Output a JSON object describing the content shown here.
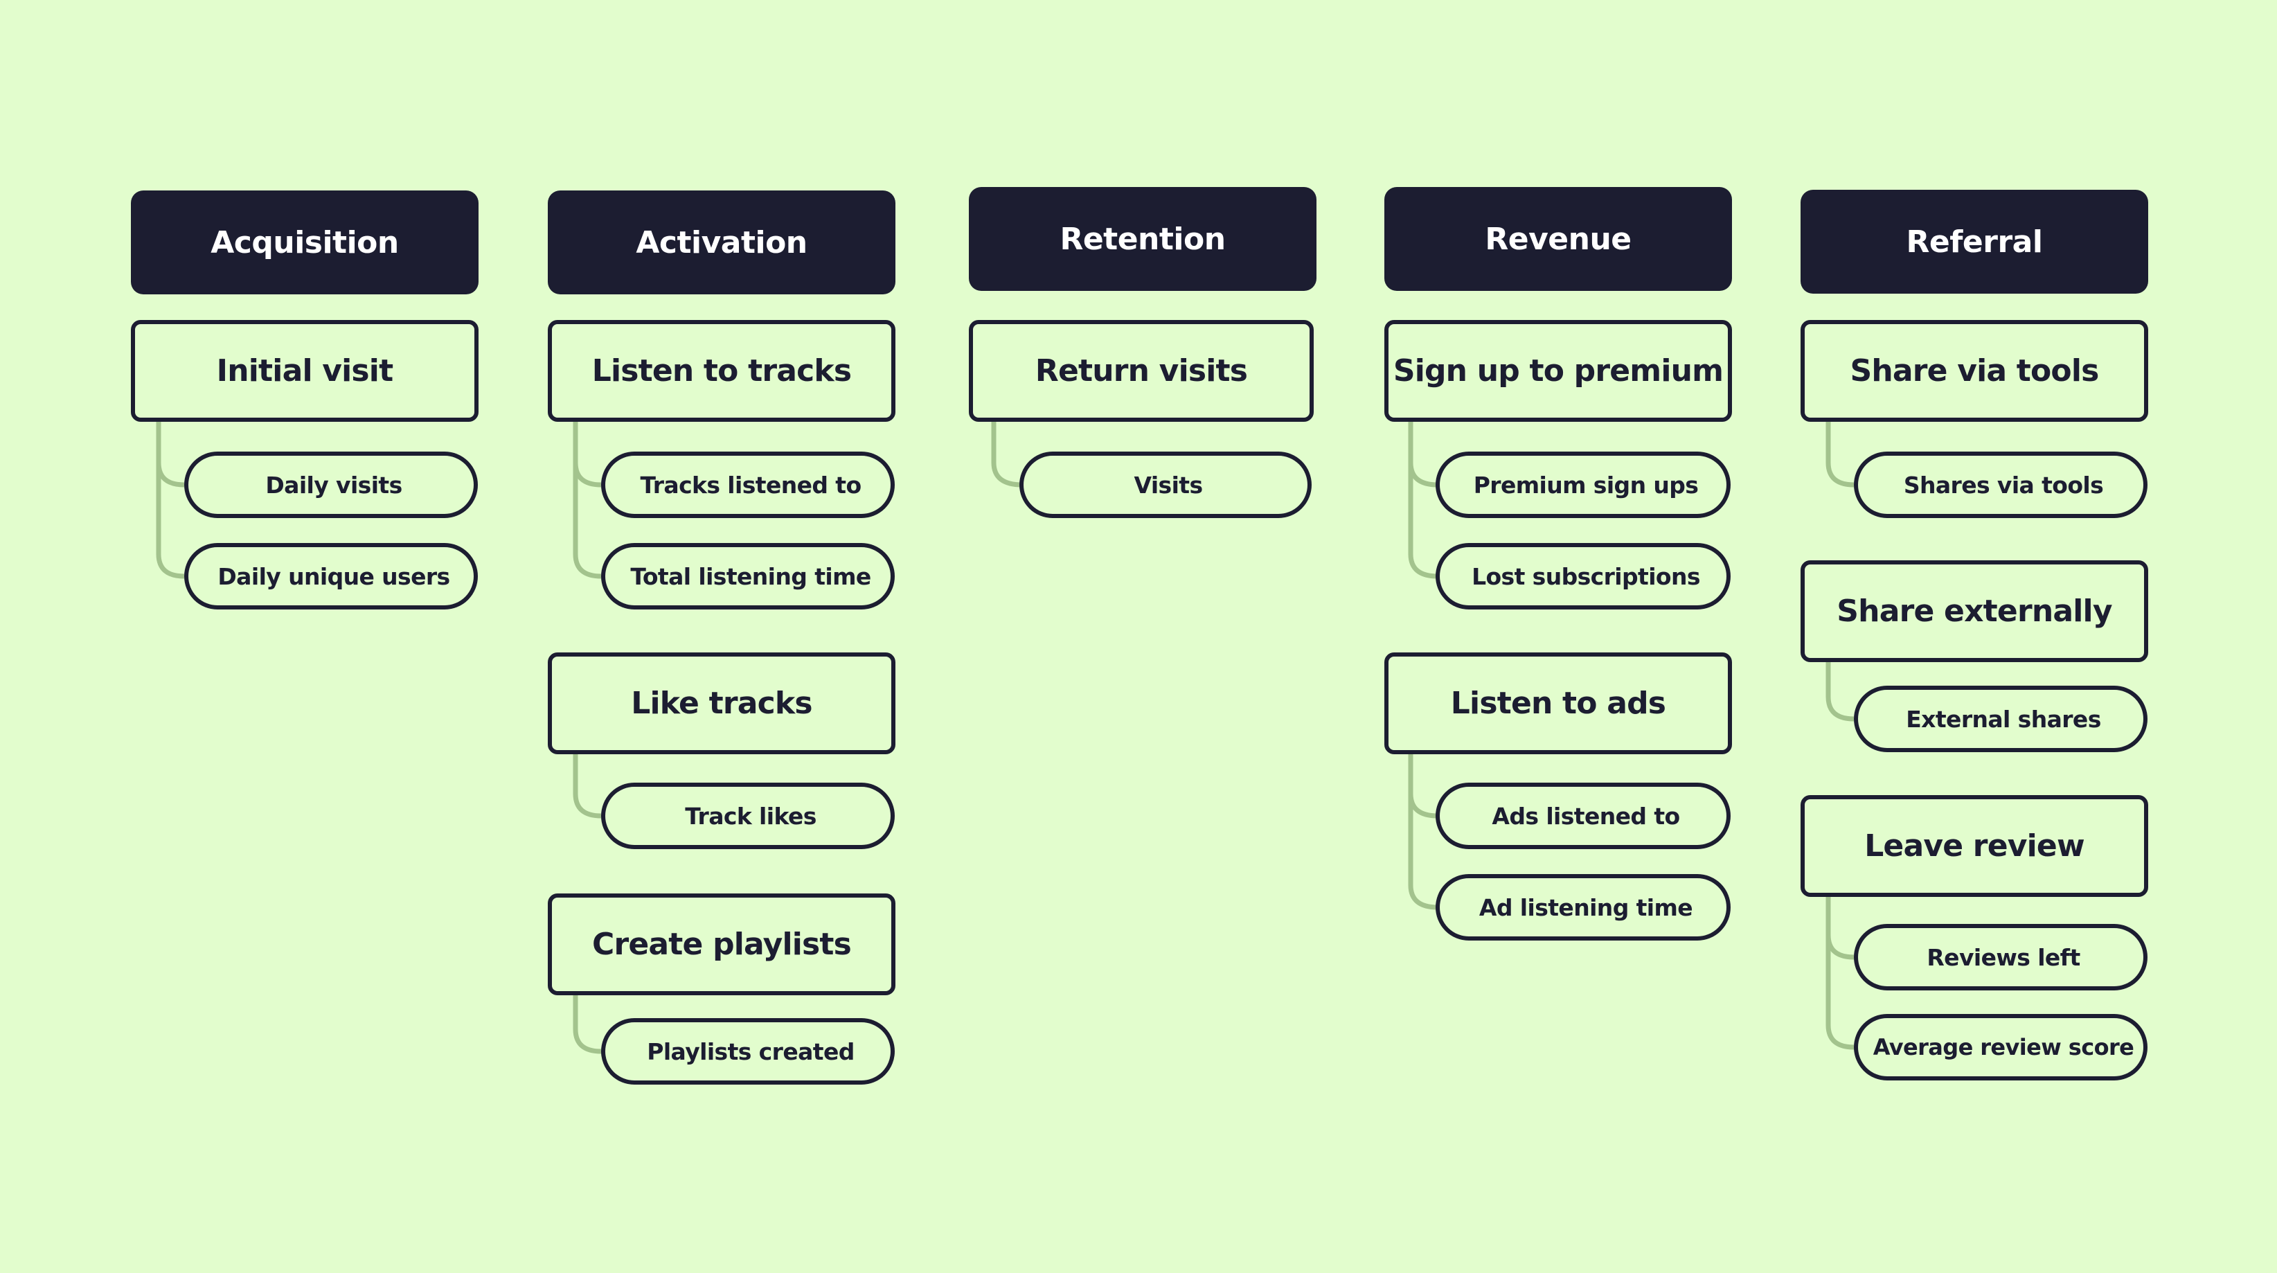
{
  "colors": {
    "background": "#e2fdcd",
    "header_fill": "#1c1d31",
    "header_text": "#ffffff",
    "outline": "#1c1d31",
    "connector": "#a3c38d"
  },
  "stages": [
    {
      "title": "Acquisition",
      "actions": [
        {
          "label": "Initial visit",
          "metrics": [
            "Daily visits",
            "Daily unique users"
          ]
        }
      ]
    },
    {
      "title": "Activation",
      "actions": [
        {
          "label": "Listen to tracks",
          "metrics": [
            "Tracks listened to",
            "Total listening time"
          ]
        },
        {
          "label": "Like tracks",
          "metrics": [
            "Track likes"
          ]
        },
        {
          "label": "Create playlists",
          "metrics": [
            "Playlists created"
          ]
        }
      ]
    },
    {
      "title": "Retention",
      "actions": [
        {
          "label": "Return visits",
          "metrics": [
            "Visits"
          ]
        }
      ]
    },
    {
      "title": "Revenue",
      "actions": [
        {
          "label": "Sign up to premium",
          "metrics": [
            "Premium sign ups",
            "Lost subscriptions"
          ]
        },
        {
          "label": "Listen to ads",
          "metrics": [
            "Ads listened to",
            "Ad listening time"
          ]
        }
      ]
    },
    {
      "title": "Referral",
      "actions": [
        {
          "label": "Share via tools",
          "metrics": [
            "Shares via tools"
          ]
        },
        {
          "label": "Share externally",
          "metrics": [
            "External shares"
          ]
        },
        {
          "label": "Leave review",
          "metrics": [
            "Reviews left",
            "Average review score"
          ]
        }
      ]
    }
  ]
}
